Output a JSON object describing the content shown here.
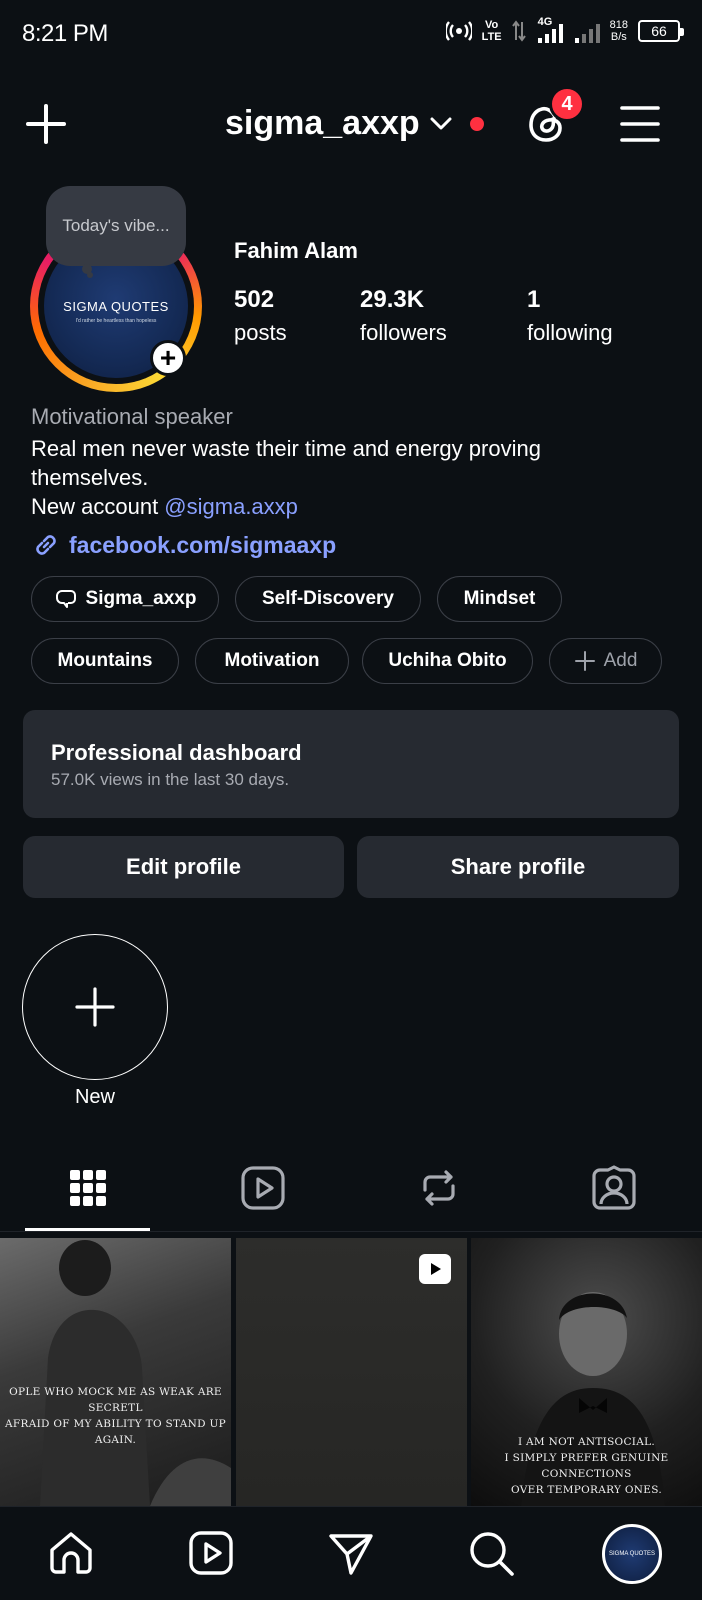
{
  "status_bar": {
    "time": "8:21 PM",
    "volte_top": "Vo",
    "volte_bottom": "LTE",
    "network": "4G",
    "speed_value": "818",
    "speed_unit": "B/s",
    "battery": "66"
  },
  "header": {
    "username": "sigma_axxp",
    "notification_count": "4",
    "icons": [
      "plus-icon",
      "chevron-down-icon",
      "threads-icon",
      "hamburger-menu-icon"
    ]
  },
  "note": {
    "text": "Today's vibe..."
  },
  "avatar": {
    "brand": "SIGMA QUOTES",
    "tagline": "I'd rather be heartless than hopeless"
  },
  "profile": {
    "display_name": "Fahim Alam",
    "stats": [
      {
        "value": "502",
        "label": "posts"
      },
      {
        "value": "29.3K",
        "label": "followers"
      },
      {
        "value": "1",
        "label": "following"
      }
    ],
    "category": "Motivational speaker",
    "bio_line1": "Real men never waste their time and energy proving themselves.",
    "bio_line2_prefix": "New account ",
    "bio_mention": "@sigma.axxp",
    "link": "facebook.com/sigmaaxp"
  },
  "chips_row1": [
    "Sigma_axxp",
    "Self-Discovery",
    "Mindset"
  ],
  "chips_row2": [
    "Mountains",
    "Motivation",
    "Uchiha Obito"
  ],
  "chip_add_label": "Add",
  "dashboard": {
    "title": "Professional dashboard",
    "subtitle": "57.0K views in the last 30 days."
  },
  "buttons": {
    "edit": "Edit profile",
    "share": "Share profile"
  },
  "highlight_new": {
    "label": "New"
  },
  "tabs": [
    "grid-icon",
    "reels-icon",
    "reposts-icon",
    "tagged-icon"
  ],
  "posts": [
    {
      "caption_line1": "OPLE WHO MOCK ME AS WEAK ARE SECRETL",
      "caption_line2": "AFRAID OF MY ABILITY TO STAND UP AGAIN."
    },
    {
      "caption_line1": "",
      "caption_line2": ""
    },
    {
      "caption_line1": "I AM NOT ANTISOCIAL.",
      "caption_line2": "I SIMPLY PREFER GENUINE CONNECTIONS",
      "caption_line3": "OVER TEMPORARY ONES."
    }
  ],
  "navbar": [
    "home-icon",
    "reels-icon",
    "direct-icon",
    "search-icon",
    "profile-avatar"
  ],
  "nav_avatar_text": "SIGMA QUOTES",
  "colors": {
    "background": "#0c1014",
    "accent_link": "#8aa0ff",
    "badge_red": "#ff3040",
    "surface": "#262a31"
  }
}
